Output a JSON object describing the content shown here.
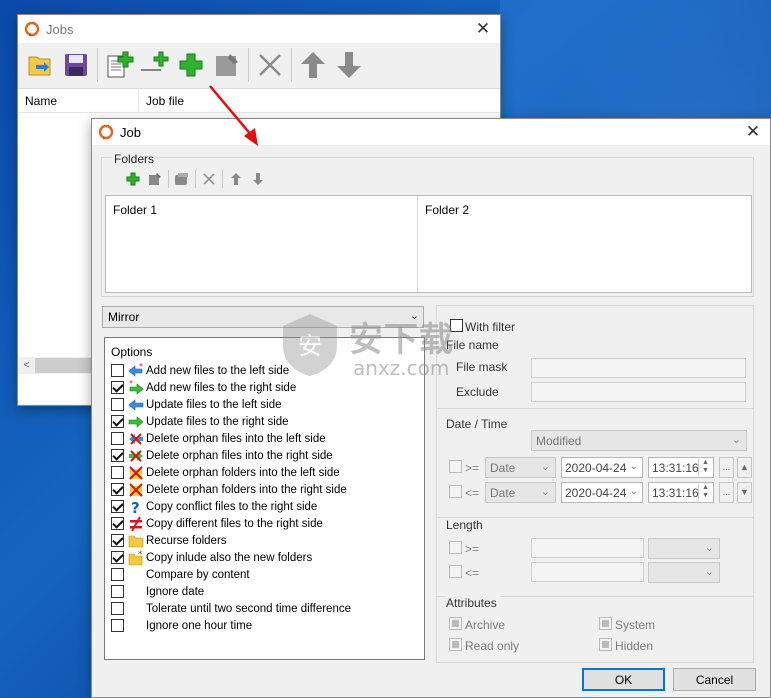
{
  "jobs_window": {
    "title": "Jobs",
    "columns": [
      "Name",
      "Job file"
    ]
  },
  "job_dialog": {
    "title": "Job",
    "folders_label": "Folders",
    "folder_columns": [
      "Folder 1",
      "Folder 2"
    ],
    "mode": "Mirror",
    "options_label": "Options",
    "options": [
      {
        "label": "Add new files to the left side",
        "checked": false,
        "icon": "add-left-icon"
      },
      {
        "label": "Add new files to the right side",
        "checked": true,
        "icon": "add-right-icon"
      },
      {
        "label": "Update files to the left side",
        "checked": false,
        "icon": "update-left-icon"
      },
      {
        "label": "Update files to the right side",
        "checked": true,
        "icon": "update-right-icon"
      },
      {
        "label": "Delete orphan files into the left side",
        "checked": false,
        "icon": "delete-files-left-icon"
      },
      {
        "label": "Delete orphan files into the right side",
        "checked": true,
        "icon": "delete-files-right-icon"
      },
      {
        "label": "Delete orphan folders into the left side",
        "checked": false,
        "icon": "delete-folders-left-icon"
      },
      {
        "label": "Delete orphan folders into the right side",
        "checked": true,
        "icon": "delete-folders-right-icon"
      },
      {
        "label": "Copy conflict files to the right side",
        "checked": true,
        "icon": "conflict-icon"
      },
      {
        "label": "Copy different files to the right side",
        "checked": true,
        "icon": "different-icon"
      },
      {
        "label": "Recurse folders",
        "checked": true,
        "icon": "folder-icon"
      },
      {
        "label": "Copy inlude also the new folders",
        "checked": true,
        "icon": "new-folder-icon"
      },
      {
        "label": "Compare by content",
        "checked": false,
        "icon": ""
      },
      {
        "label": "Ignore date",
        "checked": false,
        "icon": ""
      },
      {
        "label": "Tolerate until two second time difference",
        "checked": false,
        "icon": ""
      },
      {
        "label": "Ignore one hour time",
        "checked": false,
        "icon": ""
      }
    ],
    "filter": {
      "with_filter_label": "With filter",
      "file_name_label": "File name",
      "file_mask_label": "File mask",
      "exclude_label": "Exclude"
    },
    "date_time": {
      "label": "Date / Time",
      "type_value": "Modified",
      "row1": {
        "op": ">=",
        "kind": "Date",
        "date": "2020-04-24",
        "time": "13:31:16"
      },
      "row2": {
        "op": "<=",
        "kind": "Date",
        "date": "2020-04-24",
        "time": "13:31:16"
      },
      "ellipsis": "..."
    },
    "length": {
      "label": "Length",
      "op1": ">=",
      "op2": "<="
    },
    "attributes": {
      "label": "Attributes",
      "archive": "Archive",
      "system": "System",
      "read_only": "Read only",
      "hidden": "Hidden"
    },
    "ok_label": "OK",
    "cancel_label": "Cancel"
  },
  "watermark": {
    "chinese": "安下载",
    "domain": "anxz.com"
  },
  "colors": {
    "accent_blue": "#0078d7",
    "add_green": "#22a322",
    "arrow_red": "#e01010"
  }
}
